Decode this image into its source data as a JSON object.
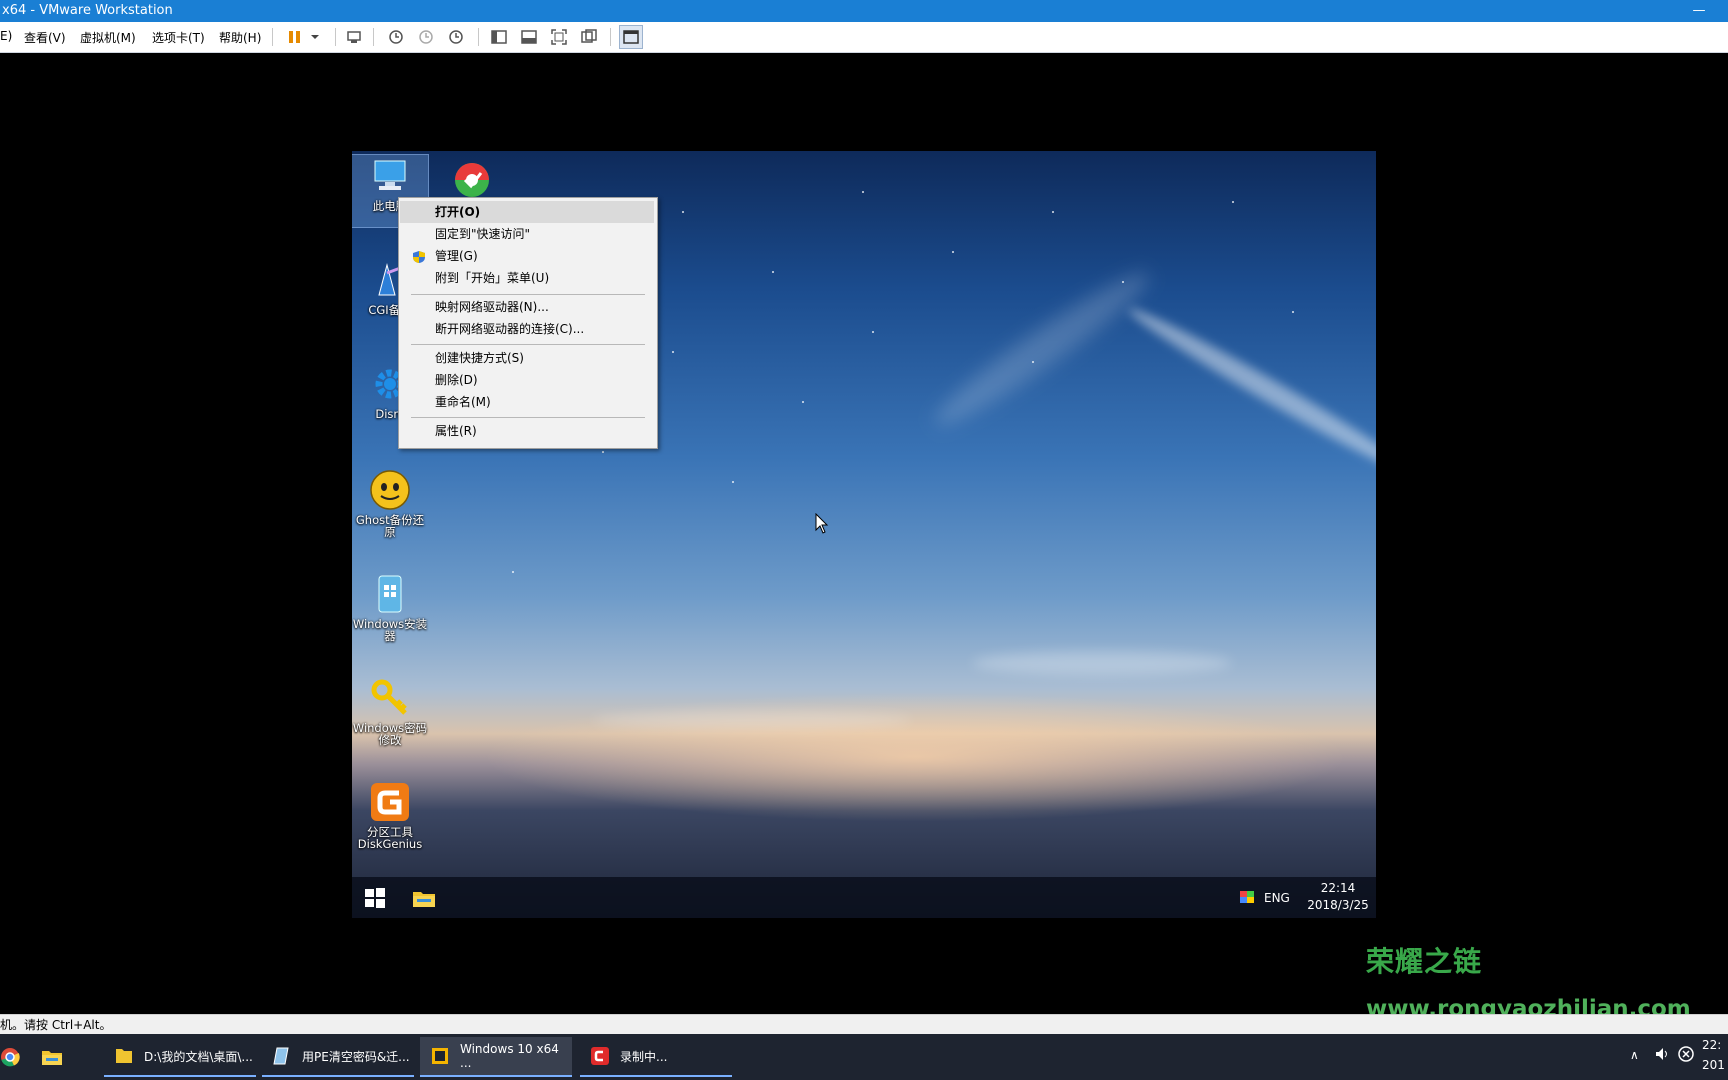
{
  "window": {
    "title": "x64 - VMware Workstation"
  },
  "menu": {
    "items": [
      "E)",
      "查看(V)",
      "虚拟机(M)",
      "选项卡(T)",
      "帮助(H)"
    ]
  },
  "toolbar": {
    "icons": [
      "pause-icon",
      "send-ctrl-alt-del-icon",
      "snapshot-icon",
      "revert-snapshot-icon",
      "snapshot-manager-icon",
      "sidebar-icon",
      "thumbnail-icon",
      "fullscreen-icon",
      "unity-icon",
      "console-view-icon"
    ]
  },
  "desktop": {
    "icons": [
      {
        "label": "此电脑",
        "icon": "computer-icon"
      },
      {
        "label": "",
        "icon": "disk-tool-icon"
      },
      {
        "label": "CGI备份",
        "icon": "cgi-backup-icon"
      },
      {
        "label": "Dism",
        "icon": "gear-icon"
      },
      {
        "label": "Ghost备份还原",
        "icon": "ghost-icon"
      },
      {
        "label": "Windows安装器",
        "icon": "windows-installer-icon"
      },
      {
        "label": "Windows密码修改",
        "icon": "key-icon"
      },
      {
        "label": "分区工具DiskGenius",
        "icon": "diskgenius-icon"
      }
    ]
  },
  "context_menu": {
    "items": [
      "打开(O)",
      "固定到\"快速访问\"",
      "管理(G)",
      "附到「开始」菜单(U)",
      "映射网络驱动器(N)...",
      "断开网络驱动器的连接(C)...",
      "创建快捷方式(S)",
      "删除(D)",
      "重命名(M)",
      "属性(R)"
    ]
  },
  "guest_taskbar": {
    "lang": "ENG",
    "time": "22:14",
    "date": "2018/3/25"
  },
  "status": {
    "hint": "机。请按 Ctrl+Alt。"
  },
  "host_taskbar": {
    "items": [
      {
        "label": "D:\\我的文档\\桌面\\...",
        "icon": "folder-icon"
      },
      {
        "label": "用PE清空密码&迁...",
        "icon": "document-icon"
      },
      {
        "label": "Windows 10 x64 ...",
        "icon": "vmware-icon"
      },
      {
        "label": "录制中...",
        "icon": "recorder-icon"
      }
    ],
    "clock_time": "22:",
    "clock_date": "201"
  },
  "watermark": {
    "title": "荣耀之链",
    "url": "www.rongyaozhilian.com"
  },
  "colors": {
    "accent": "#1a7fd4",
    "taskbar": "#1e2430",
    "watermark": "#39a84a"
  }
}
